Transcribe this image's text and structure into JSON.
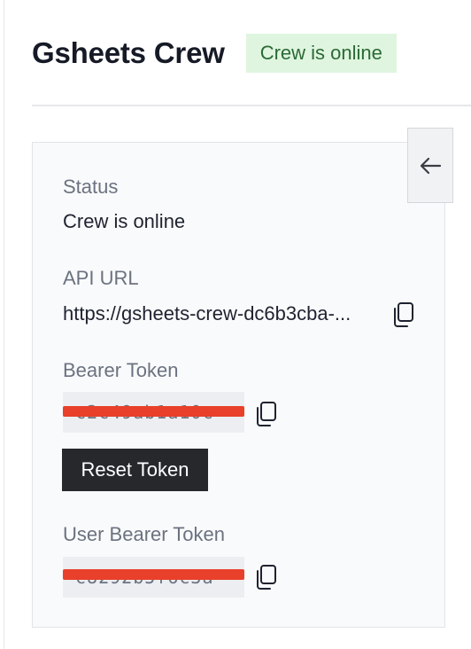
{
  "header": {
    "title": "Gsheets Crew",
    "status_badge": "Crew is online"
  },
  "details": {
    "status_label": "Status",
    "status_value": "Crew is online",
    "api_url_label": "API URL",
    "api_url_value": "https://gsheets-crew-dc6b3cba-...",
    "bearer_token_label": "Bearer Token",
    "bearer_token_value": "c2c49ab1a10c",
    "reset_token_label": "Reset Token",
    "user_bearer_token_label": "User Bearer Token",
    "user_bearer_token_value": "c8292b5f6c3a"
  },
  "icons": {
    "back": "arrow-left-icon",
    "copy": "copy-icon"
  },
  "colors": {
    "badge_bg": "#dff5df",
    "badge_text": "#2a6a36",
    "redaction": "#e8402a",
    "button_bg": "#26282c"
  }
}
